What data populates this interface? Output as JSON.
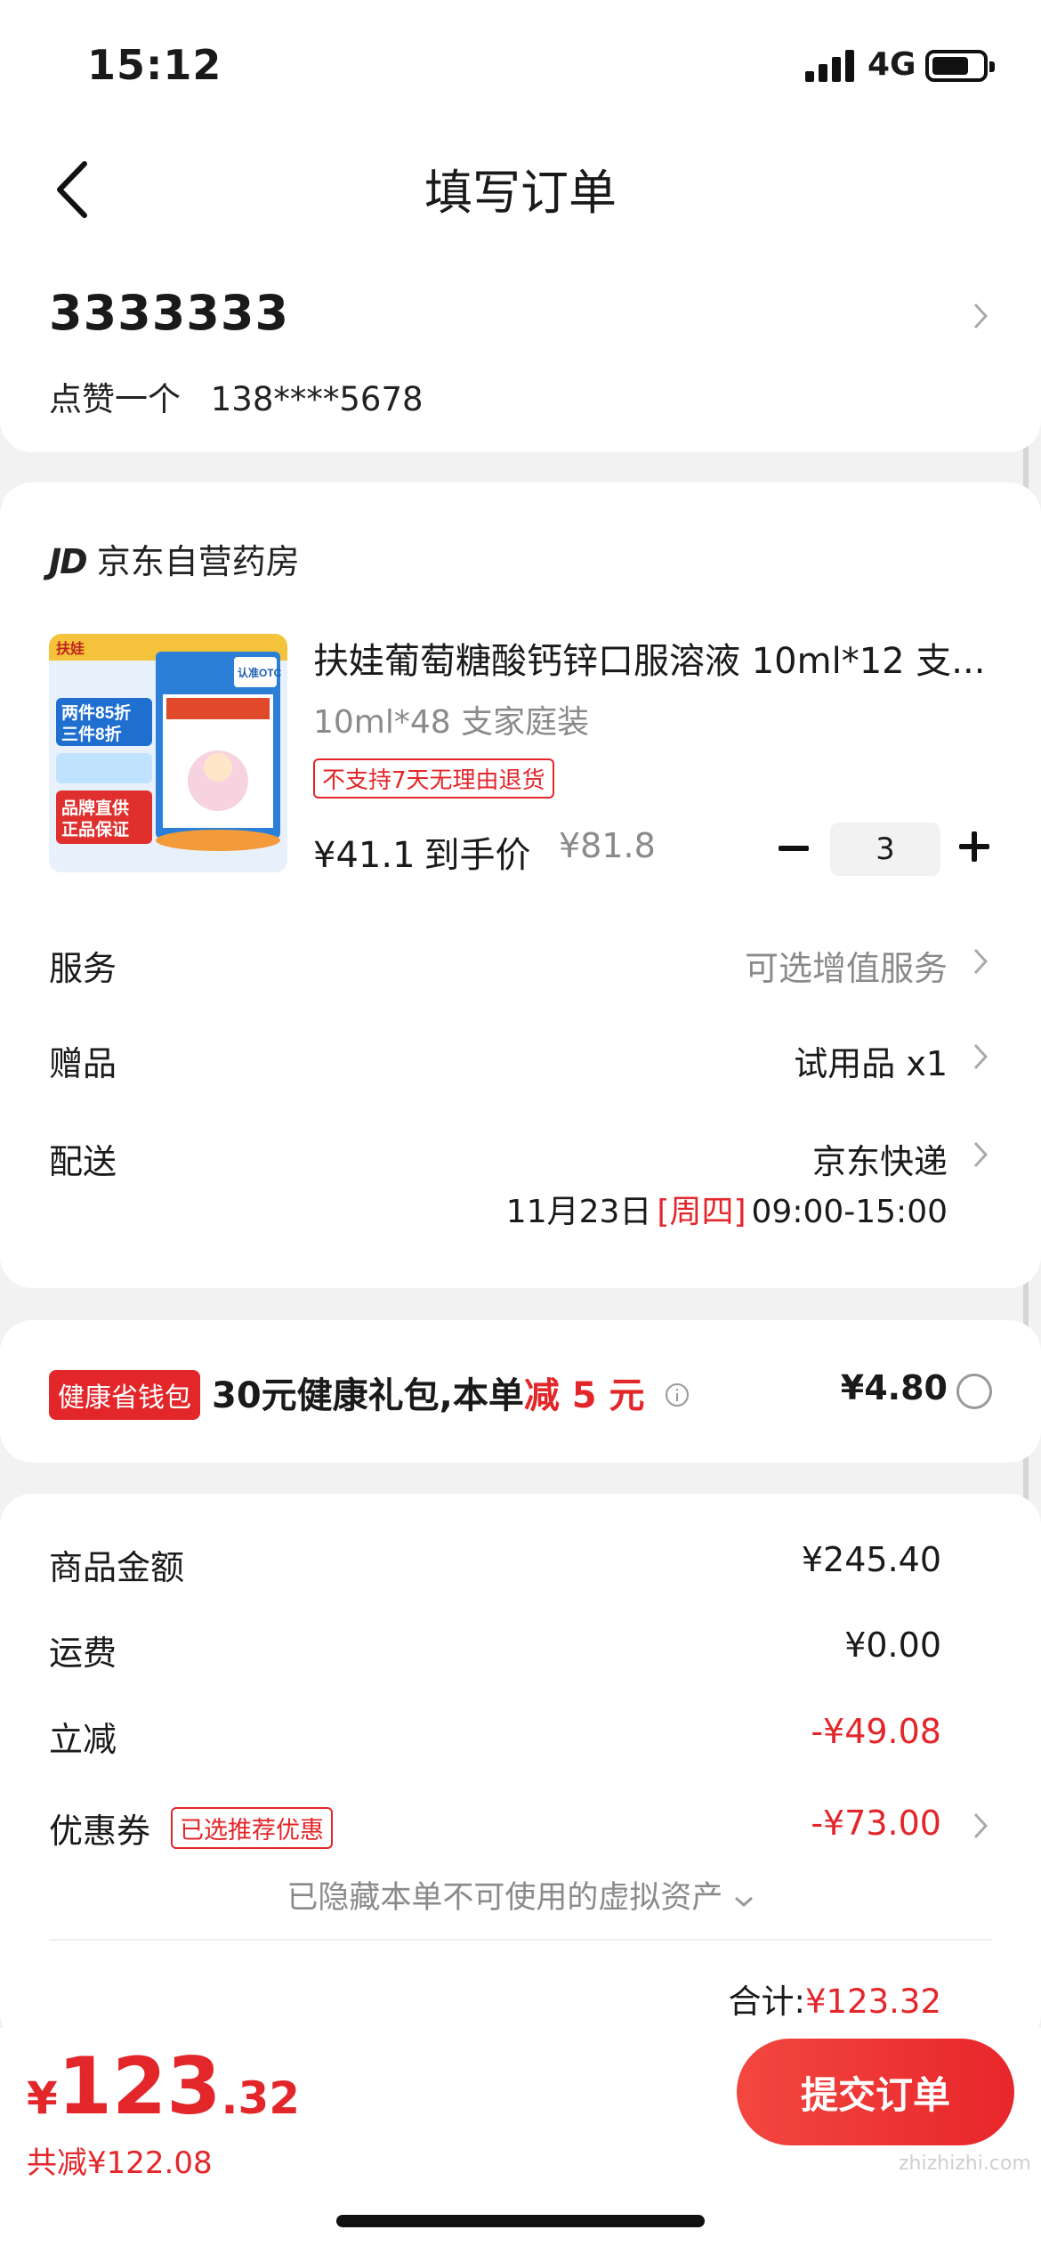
{
  "status": {
    "time": "15:12",
    "network": "4G"
  },
  "nav": {
    "title": "填写订单"
  },
  "address": {
    "name": "3333333",
    "contact": "点赞一个",
    "phone": "138****5678"
  },
  "store": {
    "logo": "JD",
    "name": "京东自营药房"
  },
  "product": {
    "title": "扶娃葡萄糖酸钙锌口服溶液 10ml*12 支...",
    "spec": "10ml*48 支家庭装",
    "tag": "不支持7天无理由退货",
    "price": "¥41.1",
    "price_label": "到手价",
    "orig_price": "¥81.8",
    "quantity": "3",
    "image_texts": {
      "brand": "扶娃",
      "promo1": "两件85折",
      "promo2": "三件8折",
      "badge1": "品牌直供",
      "badge2": "正品保证",
      "otc": "认准OTC"
    }
  },
  "rows": {
    "service": {
      "label": "服务",
      "value": "可选增值服务"
    },
    "gift": {
      "label": "赠品",
      "value": "试用品 x1"
    },
    "delivery": {
      "label": "配送",
      "value": "京东快递",
      "date": "11月23日",
      "weekday": "[周四]",
      "window": "09:00-15:00"
    }
  },
  "wallet": {
    "tag": "健康省钱包",
    "text": "30元健康礼包,本单",
    "highlight": "减 5 元",
    "price": "¥4.80"
  },
  "summary": {
    "goods_label": "商品金额",
    "goods": "¥245.40",
    "freight_label": "运费",
    "freight": "¥0.00",
    "discount_label": "立减",
    "discount": "-¥49.08",
    "coupon_label": "优惠券",
    "coupon_tag": "已选推荐优惠",
    "coupon": "-¥73.00",
    "hidden": "已隐藏本单不可使用的虚拟资产",
    "total_label": "合计:",
    "total": "¥123.32"
  },
  "footer": {
    "symbol": "¥",
    "int": "123",
    "dec": ".32",
    "saved": "共减¥122.08",
    "submit": "提交订单"
  },
  "watermark": "zhizhizhi.com",
  "colors": {
    "accent": "#e3262a",
    "background": "#f2f2f2"
  }
}
